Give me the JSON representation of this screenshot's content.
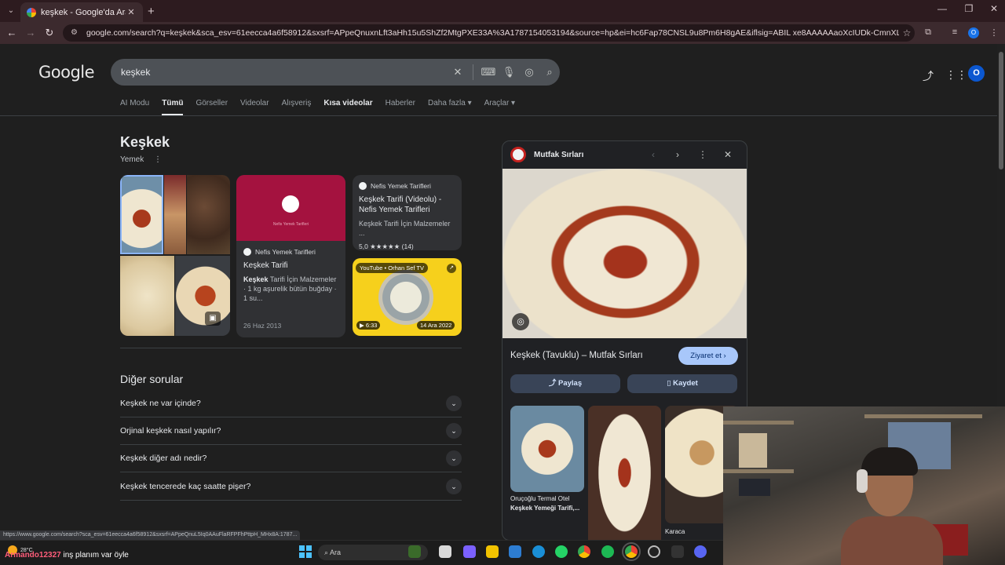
{
  "browser": {
    "tab_title": "keşkek - Google'da Ara",
    "url": "google.com/search?q=keşkek&sca_esv=61eecca4a6f58912&sxsrf=APpeQnuxnLft3aHh15u5ShZf2MtgPXE33A%3A1787154053194&source=hp&ei=hc6Fap78CNSL9u8Pm6H8gAE&iflsig=ABIL xe8AAAAAaoXcIUDk-CmnXL6GcYRELDbnzkSoQBFr&ved=...",
    "status_url": "https://www.google.com/search?sca_esv=61eecca4a6f58912&sxsrf=APpeQnuL5Iq0AAuFlaRFPFhPttpH_MHx8A:1787..."
  },
  "google": {
    "logo": "Google",
    "query": "keşkek",
    "avatar_letter": "O",
    "tabs": [
      "AI Modu",
      "Tümü",
      "Görseller",
      "Videolar",
      "Alışveriş",
      "Kısa videolar",
      "Haberler",
      "Daha fazla ▾",
      "Araçlar ▾"
    ]
  },
  "knowledge": {
    "title": "Keşkek",
    "subtitle": "Yemek"
  },
  "cards": {
    "c1": {
      "source": "Nefis Yemek Tarifleri",
      "title": "Keşkek Tarifi",
      "desc_bold": "Keşkek",
      "desc": " Tarifi İçin Malzemeler · 1 kg aşurelik bütün buğday · 1 su...",
      "date": "26 Haz 2013",
      "hero_sub": "Nefis Yemek Tarifleri"
    },
    "c2": {
      "source": "Nefis Yemek Tarifleri",
      "title": "Keşkek Tarifi (Videolu) - Nefis Yemek Tarifleri",
      "desc": "Keşkek Tarifi İçin Malzemeler ...",
      "rating": "5,0 ★★★★★ (14)"
    },
    "c3": {
      "channel": "YouTube • Orhan Sef TV",
      "duration": "▶ 6:33",
      "date": "14 Ara 2022"
    }
  },
  "paa": {
    "title": "Diğer sorular",
    "items": [
      "Keşkek ne var içinde?",
      "Orjinal keşkek nasıl yapılır?",
      "Keşkek diğer adı nedir?",
      "Keşkek tencerede kaç saatte pişer?"
    ]
  },
  "panel": {
    "site": "Mutfak Sırları",
    "title": "Keşkek (Tavuklu) – Mutfak Sırları",
    "visit": "Ziyaret et ›",
    "share": "Paylaş",
    "save": "Kaydet",
    "thumb1_source": "Oruçoğlu Termal Otel",
    "thumb1_title": "Keşkek Yemeği Tarifi,...",
    "thumb3_source": "Karaca"
  },
  "taskbar": {
    "temperature": "28°C",
    "search_placeholder": "Ara",
    "chat_user": "Armando12327",
    "chat_text": " inş planım var öyle"
  },
  "colors": {
    "accent": "#8ab4f8",
    "visit_button": "#a8c7fa",
    "avatar": "#0b57d0",
    "chrome_frame": "#3c2a2e"
  }
}
